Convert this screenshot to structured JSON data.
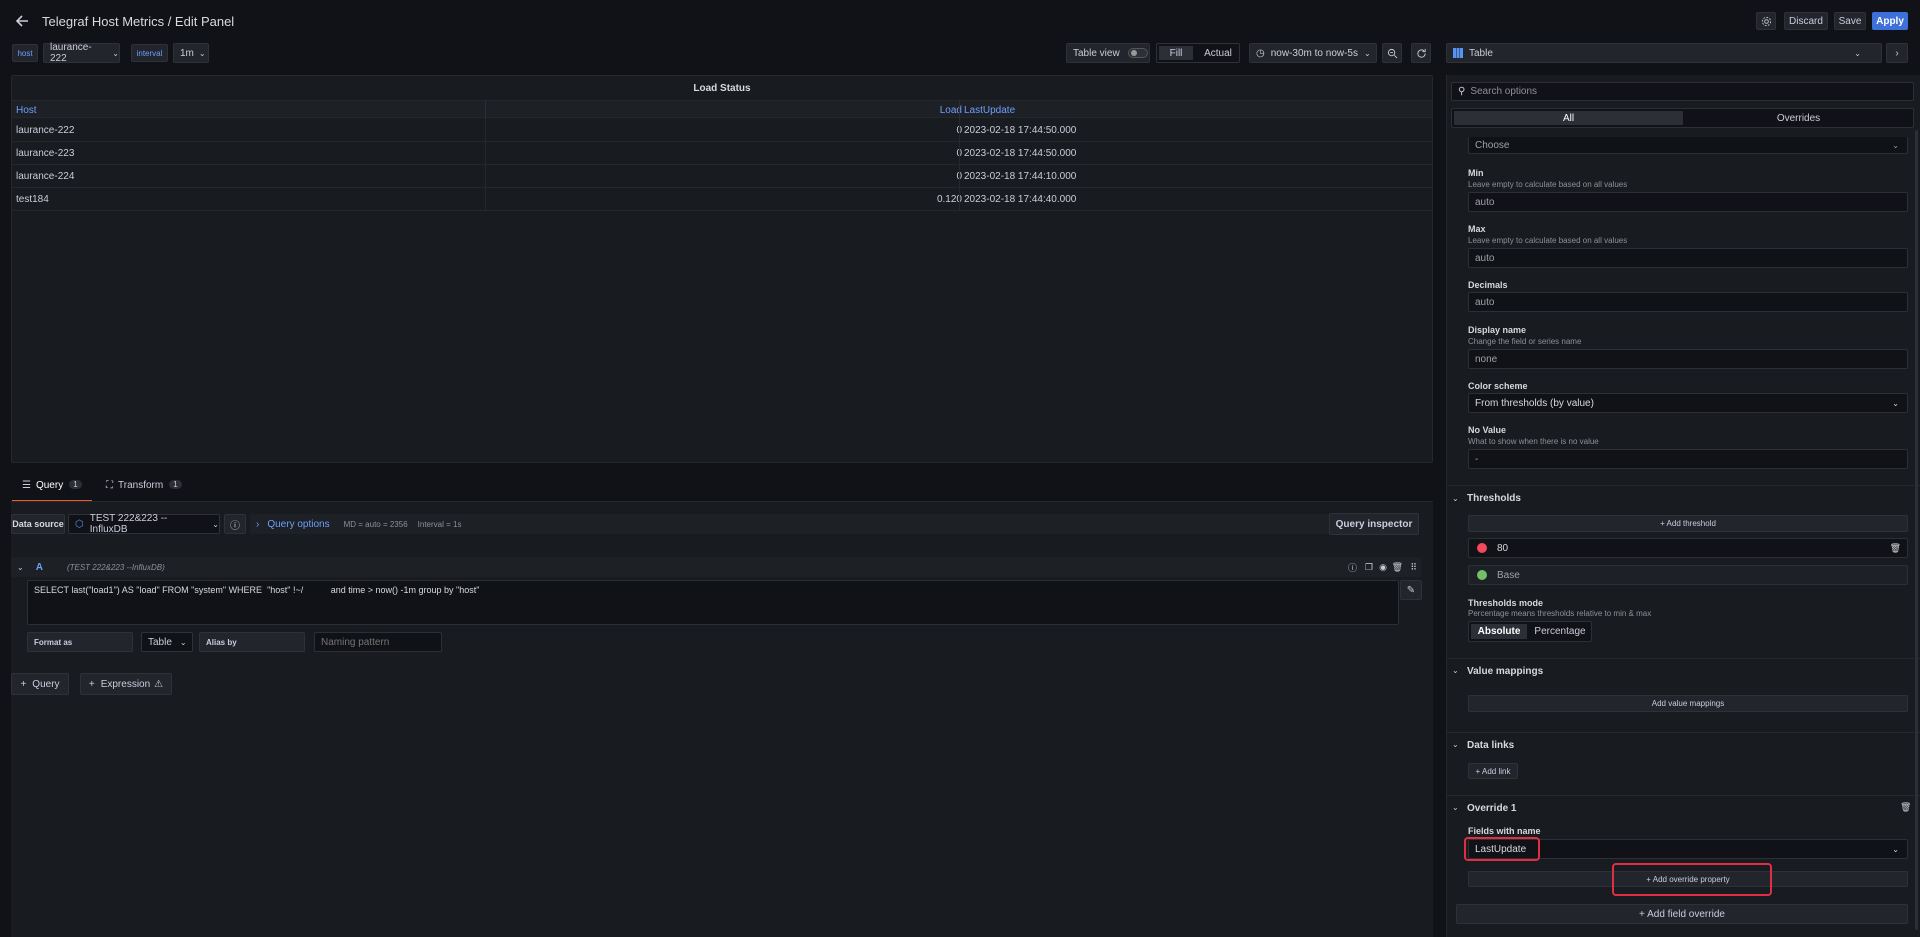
{
  "header": {
    "title": "Telegraf Host Metrics / Edit Panel",
    "discard": "Discard",
    "save": "Save",
    "apply": "Apply"
  },
  "vars": {
    "host_label": "host",
    "host_value": "laurance-222",
    "interval_label": "interval",
    "interval_value": "1m"
  },
  "toolbar": {
    "table_view": "Table view",
    "fill": "Fill",
    "actual": "Actual",
    "time_range": "now-30m to now-5s"
  },
  "viz": {
    "name": "Table"
  },
  "panel": {
    "title": "Load Status",
    "columns": [
      "Host",
      "Load",
      "LastUpdate"
    ],
    "rows": [
      [
        "laurance-222",
        "0",
        "2023-02-18 17:44:50.000"
      ],
      [
        "laurance-223",
        "0",
        "2023-02-18 17:44:50.000"
      ],
      [
        "laurance-224",
        "0",
        "2023-02-18 17:44:10.000"
      ],
      [
        "test184",
        "0.120",
        "2023-02-18 17:44:40.000"
      ]
    ]
  },
  "query_tabs": {
    "query": "Query",
    "query_count": "1",
    "transform": "Transform",
    "transform_count": "1"
  },
  "datasource": {
    "label": "Data source",
    "value": "TEST 222&223 --InfluxDB",
    "query_options": "Query options",
    "md": "MD = auto = 2356",
    "interval": "Interval = 1s",
    "inspector": "Query inspector"
  },
  "query_a": {
    "ref": "A",
    "ds": "(TEST 222&223 --InfluxDB)",
    "sql": "SELECT last(\"load1\") AS \"load\" FROM \"system\" WHERE  \"host\" !~/           and time > now() -1m group by \"host\"",
    "format_label": "Format as",
    "format_value": "Table",
    "alias_label": "Alias by",
    "alias_placeholder": "Naming pattern"
  },
  "add": {
    "query": "Query",
    "expression": "Expression"
  },
  "options": {
    "search_placeholder": "Search options",
    "tab_all": "All",
    "tab_overrides": "Overrides",
    "choose": "Choose",
    "min_label": "Min",
    "min_desc": "Leave empty to calculate based on all values",
    "min_value": "auto",
    "max_label": "Max",
    "max_desc": "Leave empty to calculate based on all values",
    "max_value": "auto",
    "dec_label": "Decimals",
    "dec_value": "auto",
    "dn_label": "Display name",
    "dn_desc": "Change the field or series name",
    "dn_value": "none",
    "cs_label": "Color scheme",
    "cs_value": "From thresholds (by value)",
    "nv_label": "No Value",
    "nv_desc": "What to show when there is no value",
    "nv_value": "-",
    "thresholds": "Thresholds",
    "add_threshold": "+ Add threshold",
    "t1": "80",
    "t2": "Base",
    "tm_label": "Thresholds mode",
    "tm_desc": "Percentage means thresholds relative to min & max",
    "tm_abs": "Absolute",
    "tm_pct": "Percentage",
    "vm": "Value mappings",
    "add_vm": "Add value mappings",
    "dl": "Data links",
    "add_link": "+ Add link",
    "ov": "Override 1",
    "fwn": "Fields with name",
    "fwn_value": "LastUpdate",
    "add_ov_prop": "+ Add override property",
    "add_field_ov": "+ Add field override"
  },
  "colors": {
    "accent": "#6e9fff",
    "apply": "#3d71d9",
    "red": "#f2495c",
    "green": "#73bf69",
    "highlight": "#e02f44"
  }
}
